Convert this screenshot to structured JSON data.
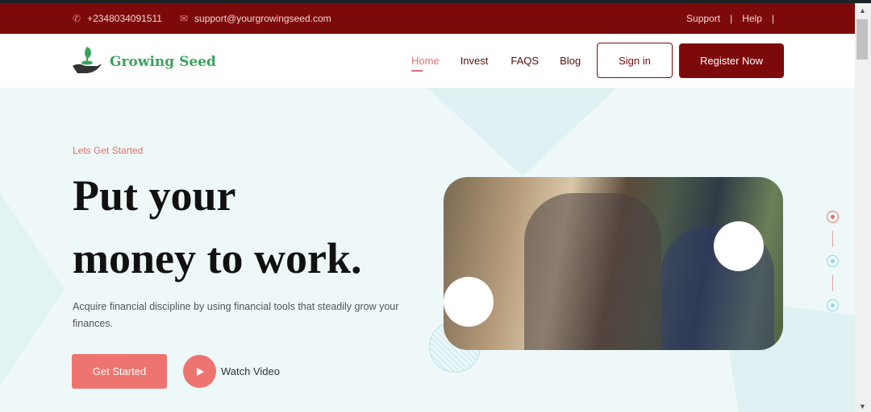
{
  "topbar": {
    "phone": "+2348034091511",
    "email": "support@yourgrowingseed.com",
    "links": [
      "Support",
      "Help"
    ]
  },
  "nav": {
    "brand": "Growing Seed",
    "links": [
      "Home",
      "Invest",
      "FAQS",
      "Blog"
    ],
    "signin": "Sign in",
    "register": "Register Now"
  },
  "hero": {
    "kicker": "Lets Get Started",
    "title_line1": "Put your",
    "title_line2": "money to work.",
    "description": "Acquire financial discipline by using financial tools that steadily grow your finances.",
    "cta": "Get Started",
    "watch": "Watch Video"
  },
  "slider": {
    "active_index": 0,
    "count": 3
  },
  "colors": {
    "primary": "#7d0a0a",
    "accent": "#ee7470",
    "brand_green": "#3aa35a"
  }
}
